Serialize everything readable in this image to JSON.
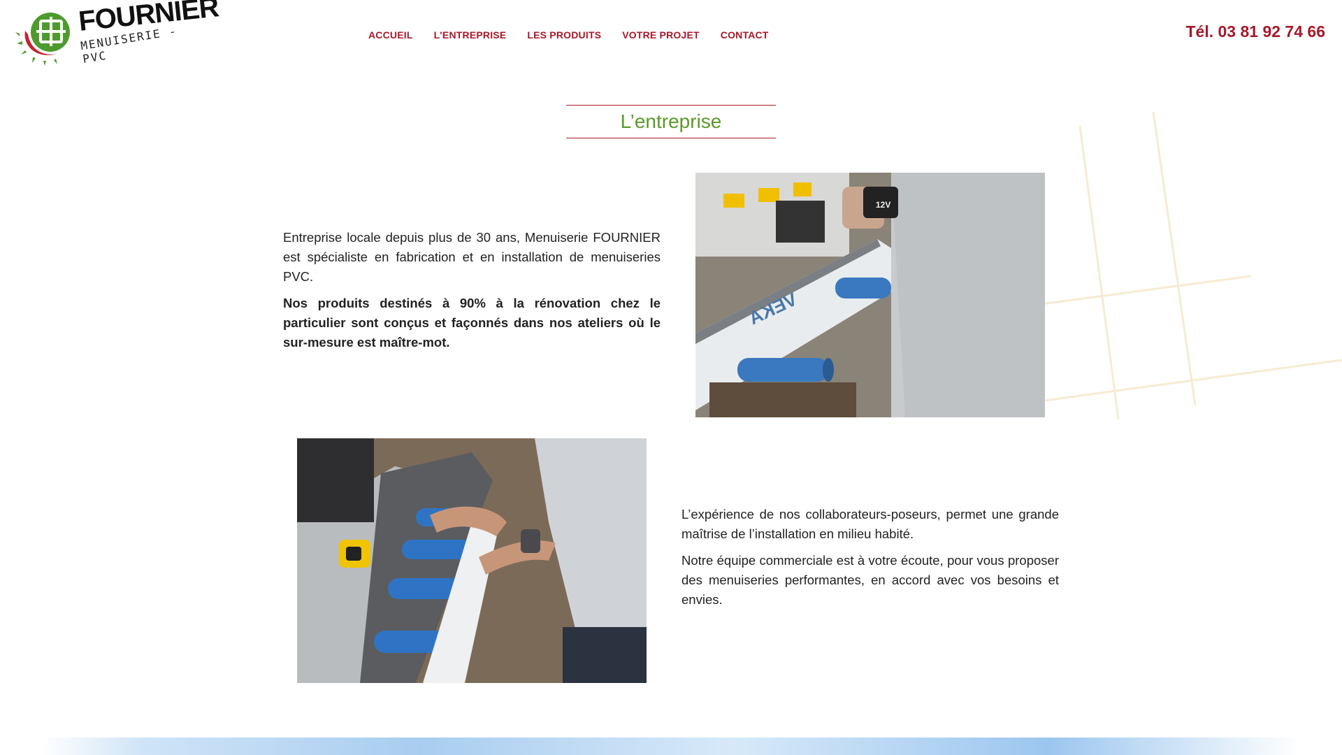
{
  "brand": {
    "name": "FOURNIER",
    "tagline": "MENUISERIE - PVC"
  },
  "nav": {
    "items": [
      {
        "label": "ACCUEIL"
      },
      {
        "label": "L'ENTREPRISE"
      },
      {
        "label": "LES PRODUITS"
      },
      {
        "label": "VOTRE PROJET"
      },
      {
        "label": "CONTACT"
      }
    ]
  },
  "phone": "Tél. 03 81 92 74 66",
  "page": {
    "title": "L’entreprise"
  },
  "section1": {
    "para1": "Entreprise locale depuis plus de 30 ans, Menuiserie FOURNIER est spécialiste en fabrication et en installation de menuiseries PVC.",
    "para2": "Nos produits destinés à 90% à la rénovation chez le particulier sont conçus et façonnés dans nos ateliers où le sur-mesure est maître-mot."
  },
  "section2": {
    "para1": "L’expérience de nos collaborateurs-poseurs, permet une grande maîtrise de l’installation en milieu habité.",
    "para2": "Notre équipe commerciale est à votre écoute, pour vous proposer des menuiseries performantes, en accord avec vos besoins et envies."
  },
  "photos": {
    "photo1_label1": "VEKA",
    "photo1_label2": "12V"
  },
  "colors": {
    "accent_red": "#a8182a",
    "title_green": "#5a9a2a",
    "logo_green": "#4e9a2e"
  }
}
